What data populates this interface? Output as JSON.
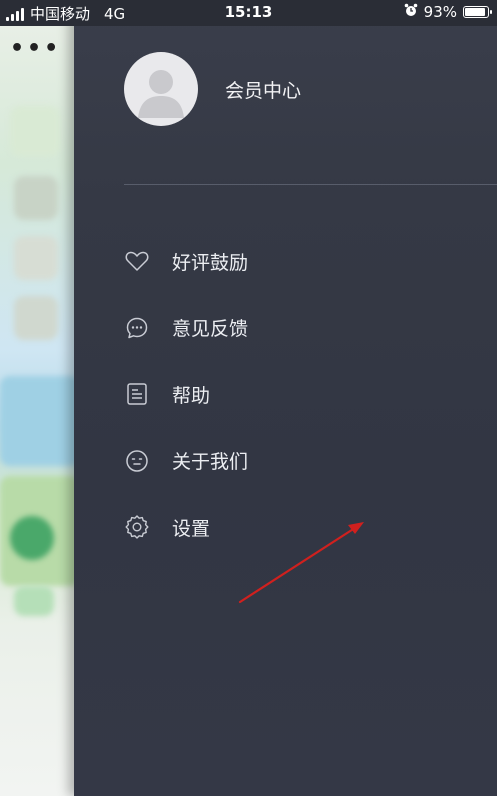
{
  "status_bar": {
    "carrier": "中国移动",
    "network": "4G",
    "time": "15:13",
    "battery": "93%",
    "battery_level": 0.93,
    "alarm_icon": "alarm-clock-icon"
  },
  "page": {
    "more_icon": "more-dots-icon"
  },
  "drawer": {
    "avatar_icon": "default-user-avatar",
    "member_center": "会员中心",
    "menu": [
      {
        "label": "好评鼓励",
        "icon": "heart-icon"
      },
      {
        "label": "意见反馈",
        "icon": "chat-bubble-icon"
      },
      {
        "label": "帮助",
        "icon": "document-icon"
      },
      {
        "label": "关于我们",
        "icon": "smiley-icon"
      },
      {
        "label": "设置",
        "icon": "gear-icon"
      }
    ]
  },
  "colors": {
    "drawer_bg": "#343846",
    "text": "#eceef2",
    "icon": "#c9ccd4",
    "annotation_arrow": "#d0201e"
  }
}
